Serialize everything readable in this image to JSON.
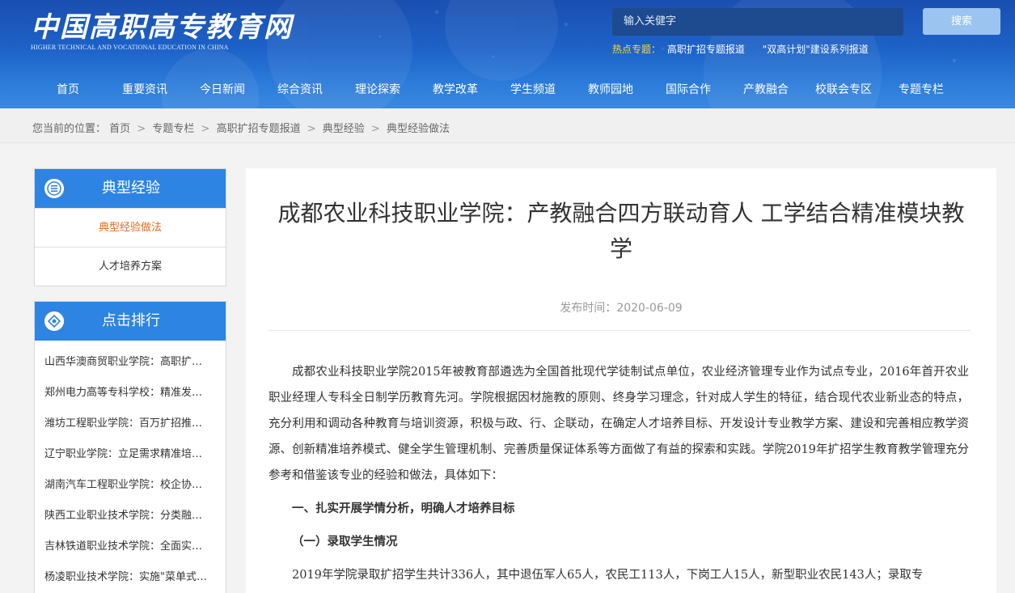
{
  "header": {
    "logo_cn": "中国高职高专教育网",
    "logo_en": "HIGHER TECHNICAL AND VOCATIONAL EDUCATION IN CHINA",
    "search_placeholder": "输入关健字",
    "search_button": "搜索",
    "hot_label": "热点专题：",
    "hot_links": [
      "高职扩招专题报道",
      "\"双高计划\"建设系列报道"
    ]
  },
  "nav": {
    "items": [
      "首页",
      "重要资讯",
      "今日新闻",
      "综合资讯",
      "理论探索",
      "教学改革",
      "学生频道",
      "教师园地",
      "国际合作",
      "产教融合",
      "校联会专区",
      "专题专栏"
    ]
  },
  "breadcrumb": {
    "prefix": "您当前的位置：",
    "items": [
      "首页",
      "专题专栏",
      "高职扩招专题报道",
      "典型经验",
      "典型经验做法"
    ],
    "separator": ">"
  },
  "sidebar": {
    "category": {
      "title": "典型经验",
      "items": [
        "典型经验做法",
        "人才培养方案"
      ]
    },
    "ranking": {
      "title": "点击排行",
      "items": [
        "山西华澳商贸职业学院：高职扩…",
        "郑州电力高等专科学校：精准发…",
        "潍坊工程职业学院：百万扩招推…",
        "辽宁职业学院：立足需求精准培…",
        "湖南汽车工程职业学院：校企协…",
        "陕西工业职业技术学院：分类融…",
        "吉林铁道职业技术学院：全面实…",
        "杨凌职业技术学院：实施\"菜单式…"
      ]
    }
  },
  "article": {
    "title": "成都农业科技职业学院：产教融合四方联动育人 工学结合精准模块教学",
    "publish_label": "发布时间：",
    "publish_date": "2020-06-09",
    "para1": "成都农业科技职业学院2015年被教育部遴选为全国首批现代学徒制试点单位，农业经济管理专业作为试点专业，2016年首开农业职业经理人专科全日制学历教育先河。学院根据因材施教的原则、终身学习理念，针对成人学生的特征，结合现代农业新业态的特点，充分利用和调动各种教育与培训资源，积极与政、行、企联动，在确定人才培养目标、开发设计专业教学方案、建设和完善相应教学资源、创新精准培养模式、健全学生管理机制、完善质量保证体系等方面做了有益的探索和实践。学院2019年扩招学生教育教学管理充分参考和借鉴该专业的经验和做法，具体如下：",
    "heading1": "一、扎实开展学情分析，明确人才培养目标",
    "heading2": "（一）录取学生情况",
    "para2": "2019年学院录取扩招学生共计336人，其中退伍军人65人，农民工113人，下岗工人15人，新型职业农民143人；录取专"
  }
}
